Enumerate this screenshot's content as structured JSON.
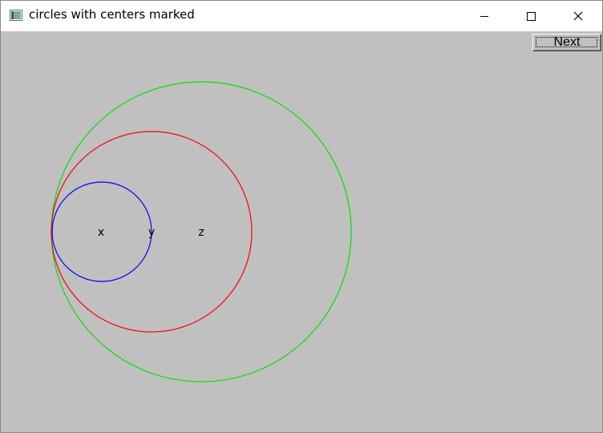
{
  "window": {
    "title": "circles with centers marked",
    "icon": "app-window-icon",
    "controls": [
      "minimize-icon",
      "maximize-icon",
      "close-icon"
    ]
  },
  "toolbar": {
    "next_label": "Next"
  },
  "circles": [
    {
      "name": "x",
      "color": "#0000ff"
    },
    {
      "name": "y",
      "color": "#ff0000"
    },
    {
      "name": "z",
      "color": "#00e000"
    }
  ],
  "labels": {
    "x": "x",
    "y": "y",
    "z": "z"
  },
  "colors": {
    "background": "#c0c0c0",
    "titlebar": "#ffffff"
  }
}
